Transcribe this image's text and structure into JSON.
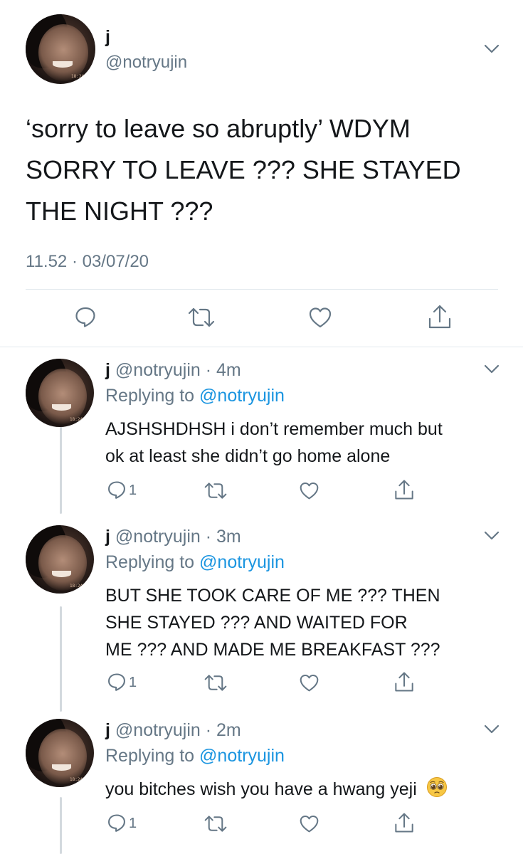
{
  "main_tweet": {
    "display_name": "j",
    "handle": "@notryujin",
    "text_lines": [
      "‘sorry to leave so abruptly’ WDYM",
      "SORRY TO LEAVE ??? SHE STAYED",
      "THE NIGHT ???"
    ],
    "timestamp": "11.52 · 03/07/20"
  },
  "replies": [
    {
      "display_name": "j",
      "handle_time": "@notryujin · 4m",
      "replying_prefix": "Replying to",
      "replying_to": "@notryujin",
      "text_lines": [
        "AJSHSHDHSH i don’t remember much but",
        "ok at least she didn’t go home alone"
      ],
      "reply_count": "1"
    },
    {
      "display_name": "j",
      "handle_time": "@notryujin · 3m",
      "replying_prefix": "Replying to",
      "replying_to": "@notryujin",
      "text_lines": [
        "BUT SHE TOOK CARE OF ME ??? THEN",
        "SHE STAYED ??? AND WAITED FOR",
        "ME ??? AND MADE ME BREAKFAST ???"
      ],
      "reply_count": "1"
    },
    {
      "display_name": "j",
      "handle_time": "@notryujin · 2m",
      "replying_prefix": "Replying to",
      "replying_to": "@notryujin",
      "text_lines": [
        "you bitches wish you have a hwang yeji"
      ],
      "emoji": "pleading-face",
      "reply_count": "1"
    }
  ],
  "colors": {
    "text": "#14171a",
    "secondary": "#657786",
    "link": "#1b95e0",
    "divider": "#e1e8ed",
    "thread_line": "#d3d9de"
  },
  "icons": [
    "reply-icon",
    "retweet-icon",
    "like-icon",
    "share-icon",
    "chevron-down-icon"
  ]
}
